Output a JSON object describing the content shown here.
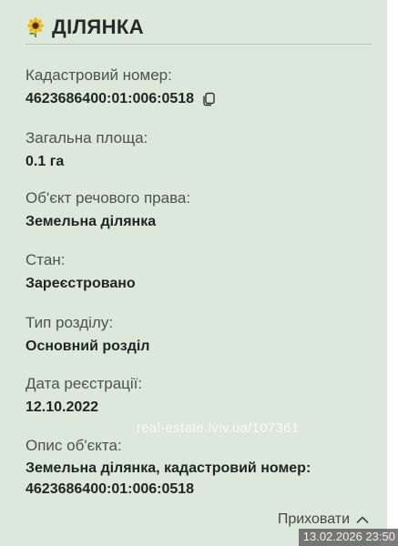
{
  "section": {
    "icon": "sunflower-icon",
    "title": "ДІЛЯНКА"
  },
  "fields": [
    {
      "label": "Кадастровий номер:",
      "value": "4623686400:01:006:0518",
      "icon": "copy-icon"
    },
    {
      "label": "Загальна площа:",
      "value": "0.1 га"
    },
    {
      "label": "Об'єкт речового права:",
      "value": "Земельна ділянка"
    },
    {
      "label": "Стан:",
      "value": "Зареєстровано"
    },
    {
      "label": "Тип розділу:",
      "value": "Основний розділ"
    },
    {
      "label": "Дата реєстрації:",
      "value": "12.10.2022"
    },
    {
      "label": "Опис об'єкта:",
      "value_lines": [
        "Земельна ділянка, кадастровий номер:",
        "4623686400:01:006:0518"
      ]
    }
  ],
  "toggle": {
    "label": "Приховати",
    "icon": "chevron-up-icon"
  },
  "watermark": "real-estate.lviv.ua/107361",
  "timestamp": "13.02.2026 23:50",
  "colors": {
    "card_background": "#dde8dd",
    "text_primary": "#1f2621",
    "text_secondary": "#4a544c"
  }
}
